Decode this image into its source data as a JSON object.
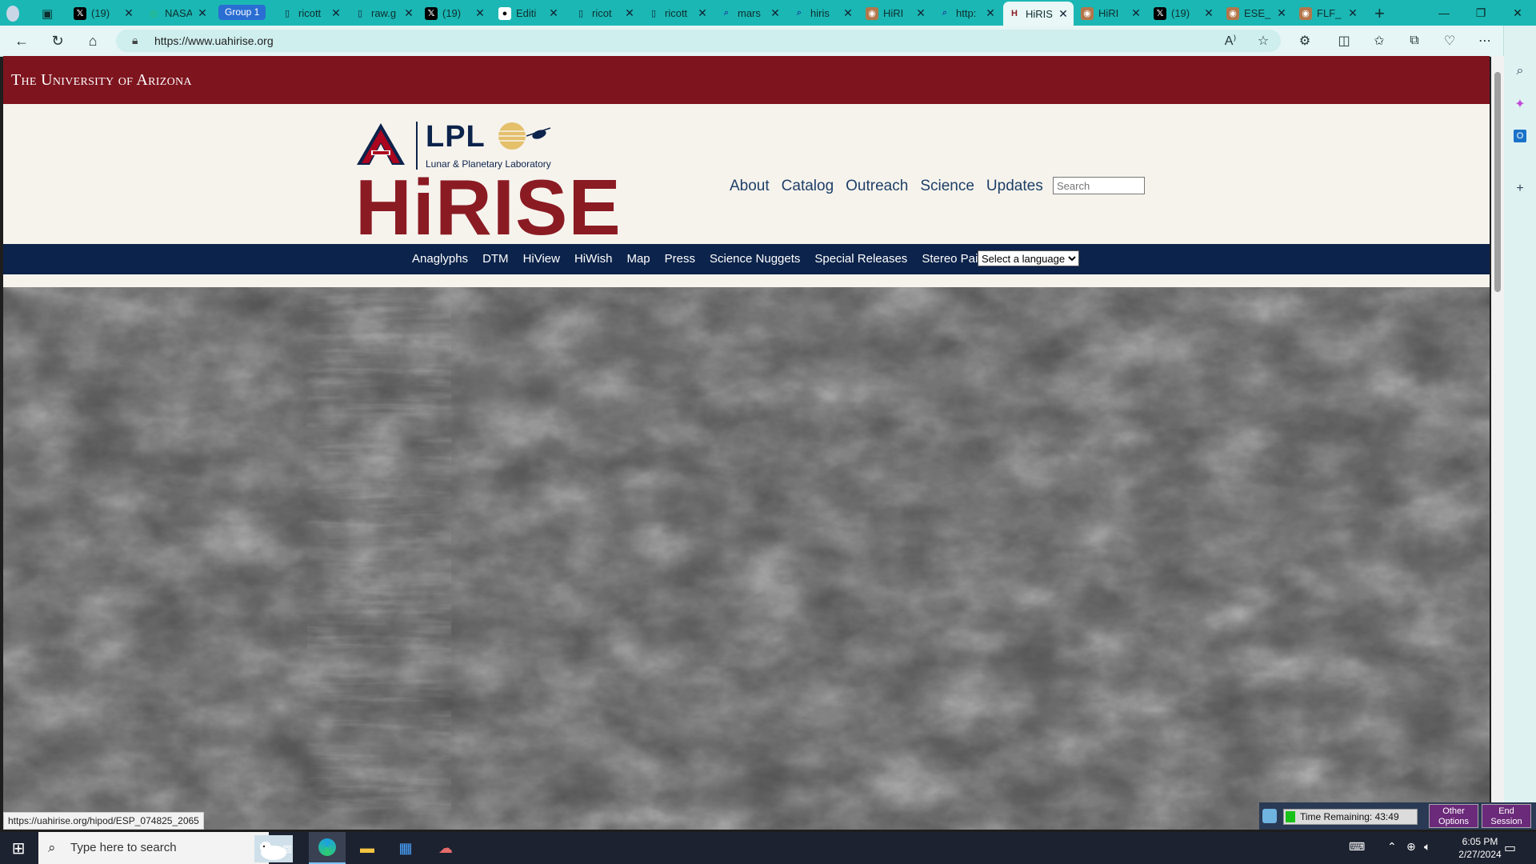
{
  "browser": {
    "tabs": [
      {
        "title": "(19)",
        "icon": "x-logo-icon"
      },
      {
        "title": "NASA",
        "icon": "globe-icon"
      },
      {
        "title": "ricott",
        "icon": "document-icon"
      },
      {
        "title": "raw.g",
        "icon": "document-icon"
      },
      {
        "title": "(19)",
        "icon": "x-logo-icon"
      },
      {
        "title": "Editi",
        "icon": "github-icon"
      },
      {
        "title": "ricot",
        "icon": "document-icon"
      },
      {
        "title": "ricott",
        "icon": "document-icon"
      },
      {
        "title": "mars",
        "icon": "search-icon"
      },
      {
        "title": "hiris",
        "icon": "search-icon"
      },
      {
        "title": "HiRI",
        "icon": "image-icon"
      },
      {
        "title": "http:",
        "icon": "search-icon"
      },
      {
        "title": "HiRIS",
        "icon": "hirise-h-icon"
      },
      {
        "title": "HiRI",
        "icon": "image-icon"
      },
      {
        "title": "(19)",
        "icon": "x-logo-icon"
      },
      {
        "title": "ESE_",
        "icon": "image-icon"
      },
      {
        "title": "FLF_",
        "icon": "image-icon"
      }
    ],
    "tab_group_label": "Group 1",
    "url": "https://www.uahirise.org",
    "status_url": "https://uahirise.org/hipod/ESP_074825_2065"
  },
  "page": {
    "university": "The University of Arizona",
    "lpl": "LPL",
    "lpl_subtitle": "Lunar & Planetary Laboratory",
    "hirise": "HiRISE",
    "main_nav": [
      "About",
      "Catalog",
      "Outreach",
      "Science",
      "Updates"
    ],
    "search_placeholder": "Search",
    "sub_nav": [
      "Anaglyphs",
      "DTM",
      "HiView",
      "HiWish",
      "Map",
      "Press",
      "Science Nuggets",
      "Special Releases",
      "Stereo Pairs"
    ],
    "language_select": "Select a language"
  },
  "session": {
    "time_remaining": "Time Remaining: 43:49",
    "other_options": "Other Options",
    "end_session": "End Session"
  },
  "taskbar": {
    "search_placeholder": "Type here to search",
    "time": "6:05 PM",
    "date": "2/27/2024"
  },
  "colors": {
    "ua_red": "#7e141e",
    "ua_navy": "#0c234b",
    "hirise_red": "#8b1b23",
    "browser_teal": "#1bb7b4"
  }
}
